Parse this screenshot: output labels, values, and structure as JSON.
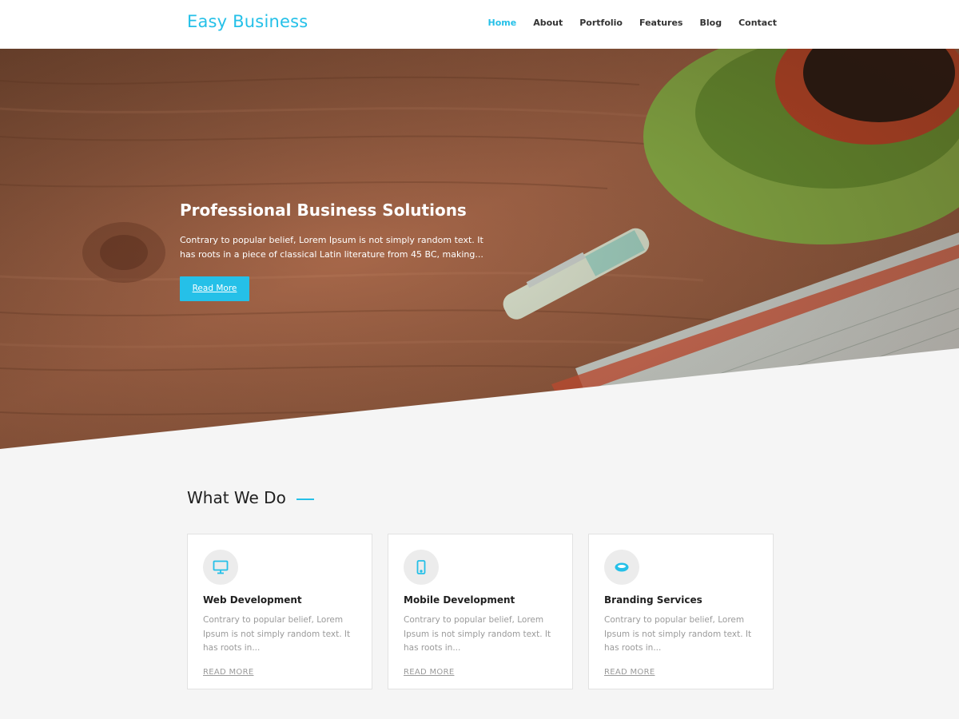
{
  "header": {
    "logo": "Easy Business",
    "nav": [
      {
        "label": "Home",
        "active": true
      },
      {
        "label": "About",
        "active": false
      },
      {
        "label": "Portfolio",
        "active": false
      },
      {
        "label": "Features",
        "active": false
      },
      {
        "label": "Blog",
        "active": false
      },
      {
        "label": "Contact",
        "active": false
      }
    ]
  },
  "hero": {
    "title": "Professional Business Solutions",
    "description": "Contrary to popular belief, Lorem Ipsum is not simply random text. It has roots in a piece of classical Latin literature from 45 BC, making...",
    "button": "Read More"
  },
  "services": {
    "title": "What We Do",
    "items": [
      {
        "icon": "monitor-icon",
        "title": "Web Development",
        "description": "Contrary to popular belief, Lorem Ipsum is not simply random text. It has roots in...",
        "link": "READ MORE"
      },
      {
        "icon": "mobile-icon",
        "title": "Mobile Development",
        "description": "Contrary to popular belief, Lorem Ipsum is not simply random text. It has roots in...",
        "link": "READ MORE"
      },
      {
        "icon": "brand-icon",
        "title": "Branding Services",
        "description": "Contrary to popular belief, Lorem Ipsum is not simply random text. It has roots in...",
        "link": "READ MORE"
      }
    ]
  },
  "colors": {
    "accent": "#25c0e8",
    "background": "#f5f5f5",
    "wood": "#8a5a3e"
  }
}
